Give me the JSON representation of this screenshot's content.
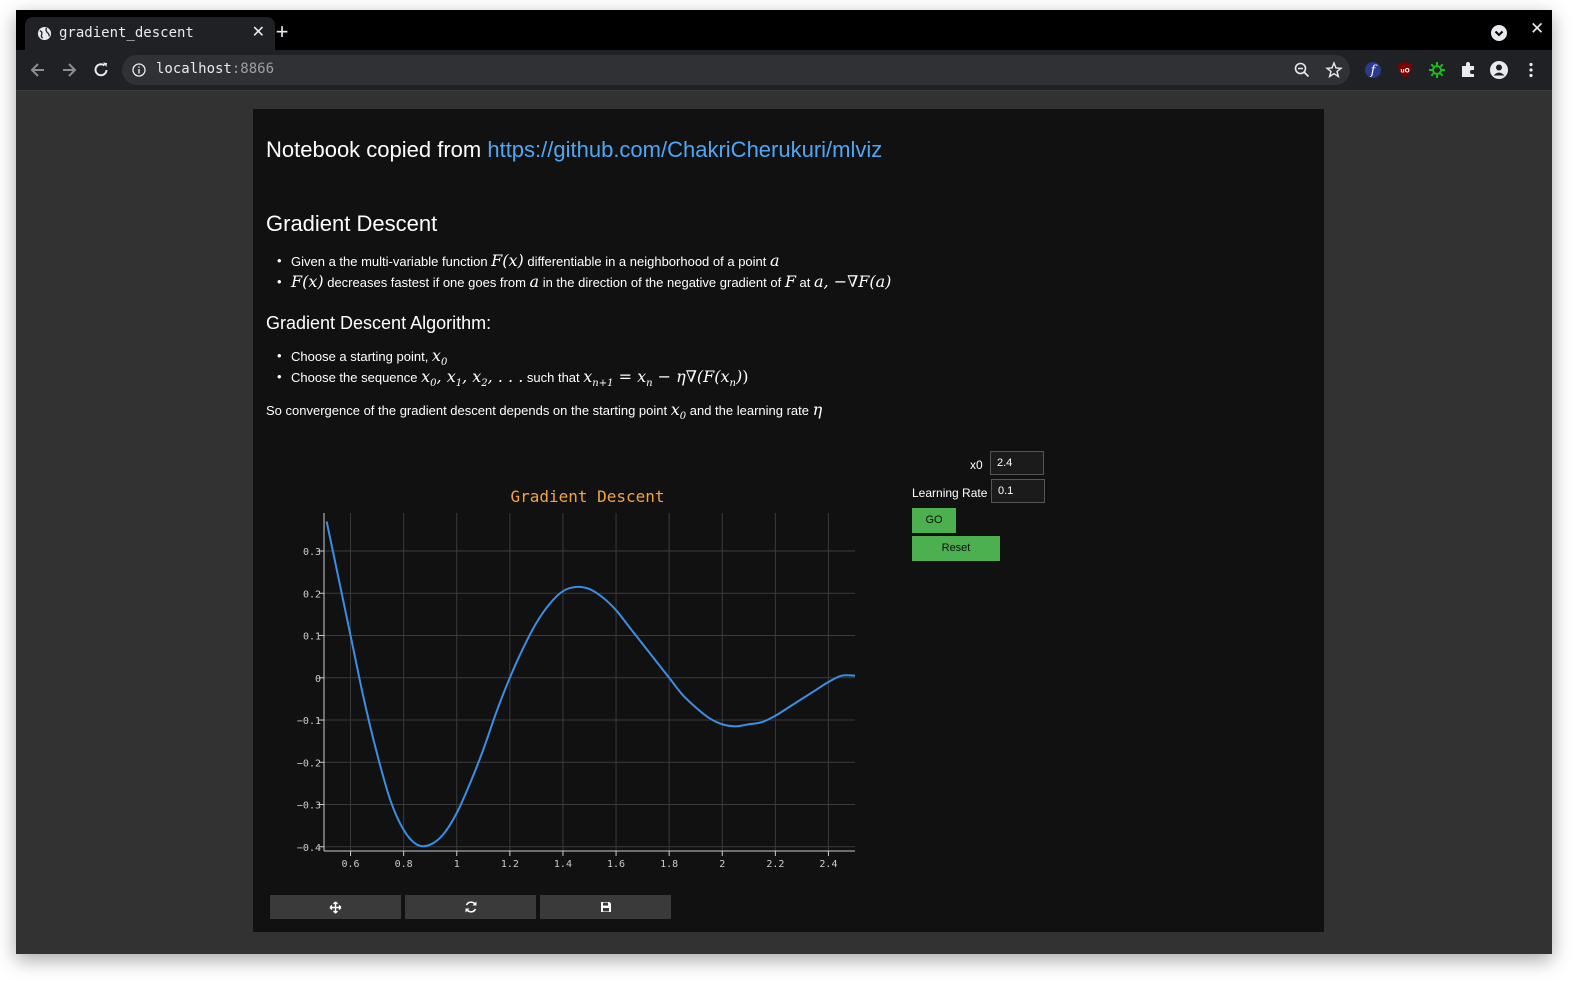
{
  "browser": {
    "tab_title": "gradient_descent",
    "url_host": "localhost",
    "url_port": ":8866"
  },
  "notebook": {
    "note_prefix": "Notebook copied from ",
    "note_link": "https://github.com/ChakriCherukuri/mlviz",
    "heading": "Gradient Descent",
    "bullets1": [
      {
        "t1": "Given a the multi-variable function ",
        "m1": "F(x)",
        "t2": " differentiable in a neighborhood of a point ",
        "m2": "a"
      },
      {
        "m1": "F(x)",
        "t1": " decreases fastest if one goes from ",
        "m2": "a",
        "t2": " in the direction of the negative gradient of ",
        "m3": "F",
        "t3": " at ",
        "m4": "a, −∇F(a)"
      }
    ],
    "algo_heading": "Gradient Descent Algorithm:",
    "bullets2": [
      {
        "t1": "Choose a starting point, "
      },
      {
        "t1": "Choose the sequence ",
        "t2": " such that "
      }
    ],
    "para": {
      "t1": "So convergence of the gradient descent depends on the starting point ",
      "t2": " and the learning rate ",
      "eta": "η"
    }
  },
  "controls": {
    "x0_label": "x0",
    "x0_value": "2.4",
    "lr_label": "Learning Rate",
    "lr_value": "0.1",
    "go_label": "GO",
    "reset_label": "Reset"
  },
  "colors": {
    "accent": "#4caf50",
    "line": "#3a8ee6",
    "title": "#f5a340",
    "link": "#4ea7f5"
  },
  "chart_data": {
    "type": "line",
    "title": "Gradient Descent",
    "xlim": [
      0.5,
      2.5
    ],
    "ylim": [
      -0.41,
      0.39
    ],
    "xticks": [
      0.6,
      0.8,
      1,
      1.2,
      1.4,
      1.6,
      1.8,
      2,
      2.2,
      2.4
    ],
    "xtick_labels": [
      "0.6",
      "0.8",
      "1",
      "1.2",
      "1.4",
      "1.6",
      "1.8",
      "2",
      "2.2",
      "2.4"
    ],
    "yticks": [
      0.3,
      0.2,
      0.1,
      0,
      -0.1,
      -0.2,
      -0.3,
      -0.4
    ],
    "ytick_labels": [
      "0.3",
      "0.2",
      "0.1",
      "0",
      "−0.1",
      "−0.2",
      "−0.3",
      "−0.4"
    ],
    "grid": true,
    "series": [
      {
        "x": [
          0.51,
          0.55,
          0.6,
          0.65,
          0.7,
          0.75,
          0.8,
          0.85,
          0.9,
          0.95,
          1.0,
          1.05,
          1.1,
          1.15,
          1.2,
          1.25,
          1.3,
          1.35,
          1.4,
          1.45,
          1.5,
          1.55,
          1.6,
          1.65,
          1.7,
          1.75,
          1.8,
          1.85,
          1.9,
          1.95,
          2.0,
          2.05,
          2.1,
          2.15,
          2.2,
          2.25,
          2.3,
          2.35,
          2.4,
          2.45,
          2.5
        ],
        "y": [
          0.37,
          0.25,
          0.1,
          -0.05,
          -0.18,
          -0.29,
          -0.36,
          -0.395,
          -0.395,
          -0.37,
          -0.32,
          -0.25,
          -0.17,
          -0.08,
          0.0,
          0.07,
          0.13,
          0.175,
          0.205,
          0.215,
          0.21,
          0.19,
          0.16,
          0.12,
          0.08,
          0.04,
          0.0,
          -0.04,
          -0.07,
          -0.095,
          -0.11,
          -0.115,
          -0.11,
          -0.105,
          -0.09,
          -0.07,
          -0.05,
          -0.03,
          -0.01,
          0.005,
          0.005
        ]
      }
    ]
  }
}
